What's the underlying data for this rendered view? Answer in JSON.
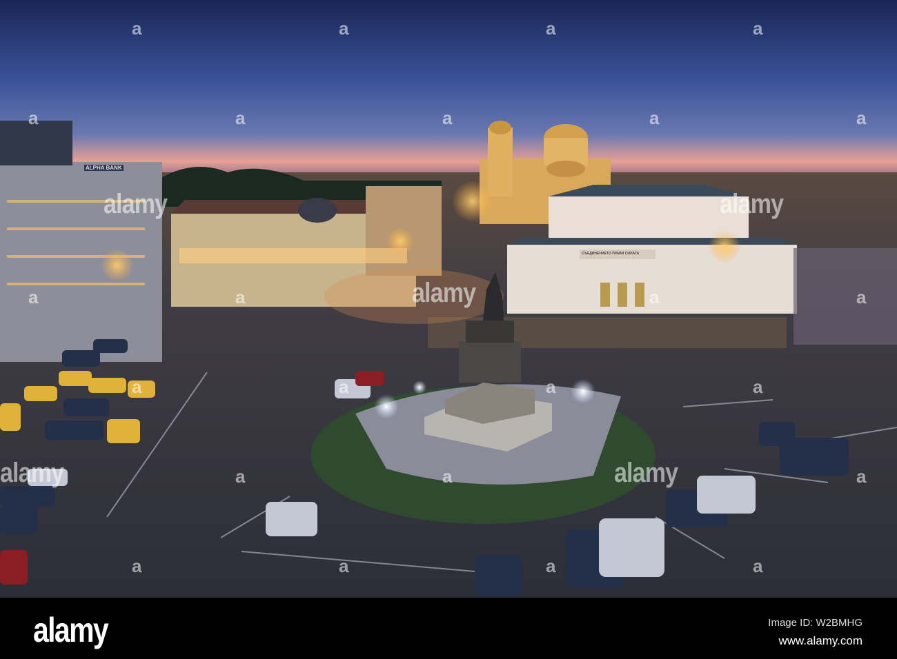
{
  "photo": {
    "signs": {
      "bank": "ALPHA BANK",
      "parliament": "СЪЕДИНЕНИЕТО ПРАВИ СИЛАТА"
    },
    "colors": {
      "sky_top": "#1c2b5e",
      "sky_mid": "#3a5299",
      "horizon": "#e89a8a",
      "plaza": "#3a3a44",
      "lamp": "#ffb84a"
    }
  },
  "watermark": {
    "small": "a",
    "word": "alamy"
  },
  "footer": {
    "logo": "alamy",
    "image_id": "Image ID: W2BMHG",
    "site": "www.alamy.com"
  }
}
